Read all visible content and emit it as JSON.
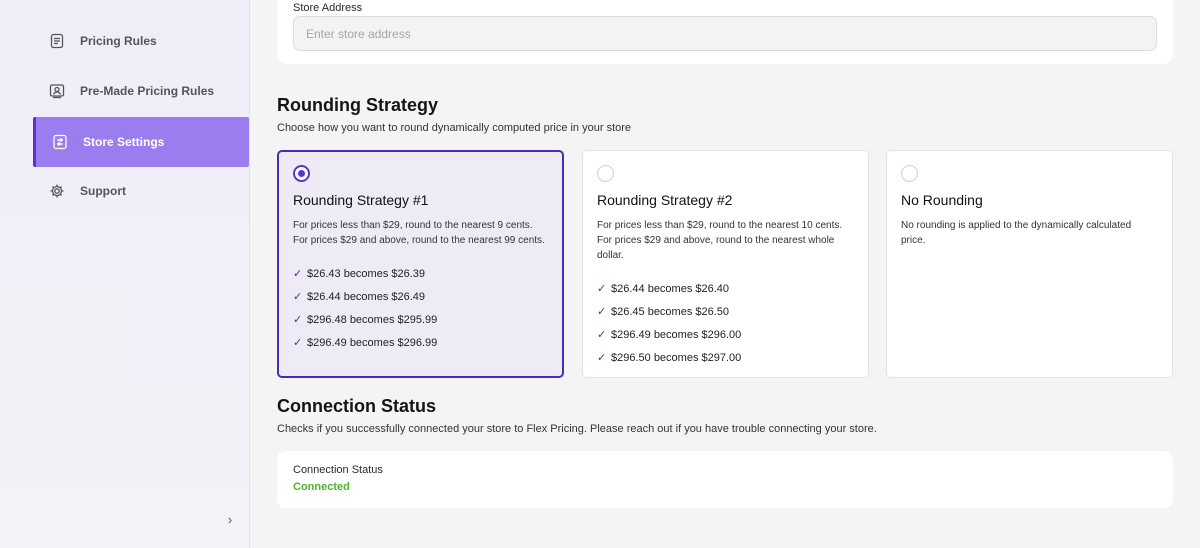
{
  "sidebar": {
    "items": [
      {
        "label": "Pricing Rules",
        "icon": "list-document-icon"
      },
      {
        "label": "Pre-Made Pricing Rules",
        "icon": "id-card-icon"
      },
      {
        "label": "Store Settings",
        "icon": "sliders-document-icon",
        "active": true
      },
      {
        "label": "Support",
        "icon": "gear-icon"
      }
    ],
    "collapse_glyph": "›"
  },
  "store_address": {
    "label": "Store Address",
    "placeholder": "Enter store address",
    "value": ""
  },
  "rounding": {
    "title": "Rounding Strategy",
    "description": "Choose how you want to round dynamically computed price in your store",
    "strategies": [
      {
        "title": "Rounding Strategy #1",
        "description": "For prices less than $29, round to the nearest 9 cents. For prices $29 and above, round to the nearest 99 cents.",
        "selected": true,
        "examples": [
          "$26.43 becomes $26.39",
          "$26.44 becomes $26.49",
          "$296.48 becomes $295.99",
          "$296.49 becomes $296.99"
        ]
      },
      {
        "title": "Rounding Strategy #2",
        "description": "For prices less than $29, round to the nearest 10 cents. For prices $29 and above, round to the nearest whole dollar.",
        "selected": false,
        "examples": [
          "$26.44 becomes $26.40",
          "$26.45 becomes $26.50",
          "$296.49 becomes $296.00",
          "$296.50 becomes $297.00"
        ]
      },
      {
        "title": "No Rounding",
        "description": "No rounding is applied to the dynamically calculated price.",
        "selected": false,
        "examples": []
      }
    ],
    "check_glyph": "✓"
  },
  "connection": {
    "title": "Connection Status",
    "description": "Checks if you successfully connected your store to Flex Pricing. Please reach out if you have trouble connecting your store.",
    "label": "Connection Status",
    "status": "Connected",
    "status_color": "#4fb52d"
  },
  "colors": {
    "accent": "#9b7df0",
    "accent_dark": "#4a2bb8",
    "selected_card_bg": "#eeebf6"
  }
}
